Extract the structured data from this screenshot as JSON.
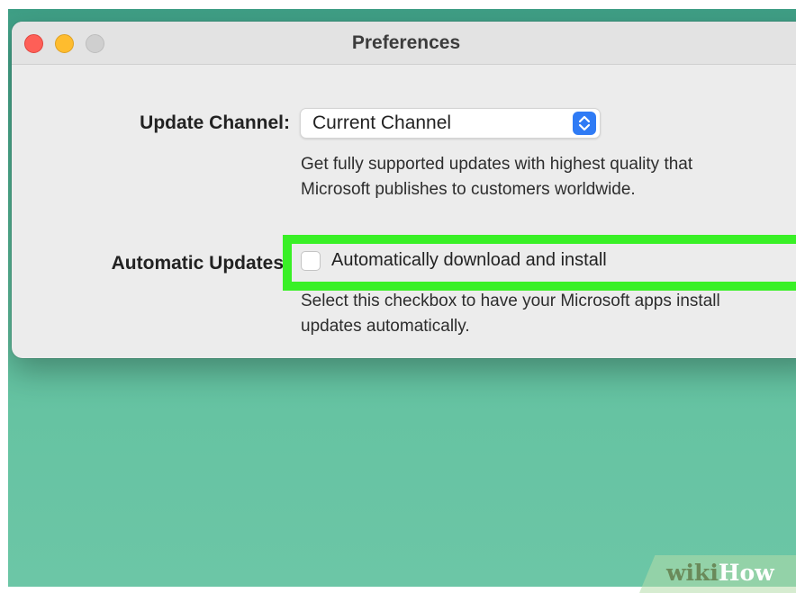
{
  "window": {
    "title": "Preferences"
  },
  "update_channel": {
    "label": "Update Channel:",
    "selected": "Current Channel",
    "description_line1": "Get fully supported updates with highest quality that",
    "description_line2": "Microsoft publishes to customers worldwide."
  },
  "automatic_updates": {
    "label": "Automatic Updates:",
    "checkbox_label": "Automatically download and install",
    "checked": false,
    "description_line1": "Select this checkbox to have your Microsoft apps install",
    "description_line2": "updates automatically."
  },
  "watermark": {
    "part1": "wiki",
    "part2": "How"
  },
  "colors": {
    "highlight": "#39f026",
    "desktop": "#66c3a2",
    "stepper_accent": "#2f7bf5"
  },
  "icons": {
    "stepper": "up-down-chevron-icon",
    "close": "close-traffic-light-icon",
    "minimize": "minimize-traffic-light-icon",
    "zoom": "zoom-traffic-light-icon"
  }
}
